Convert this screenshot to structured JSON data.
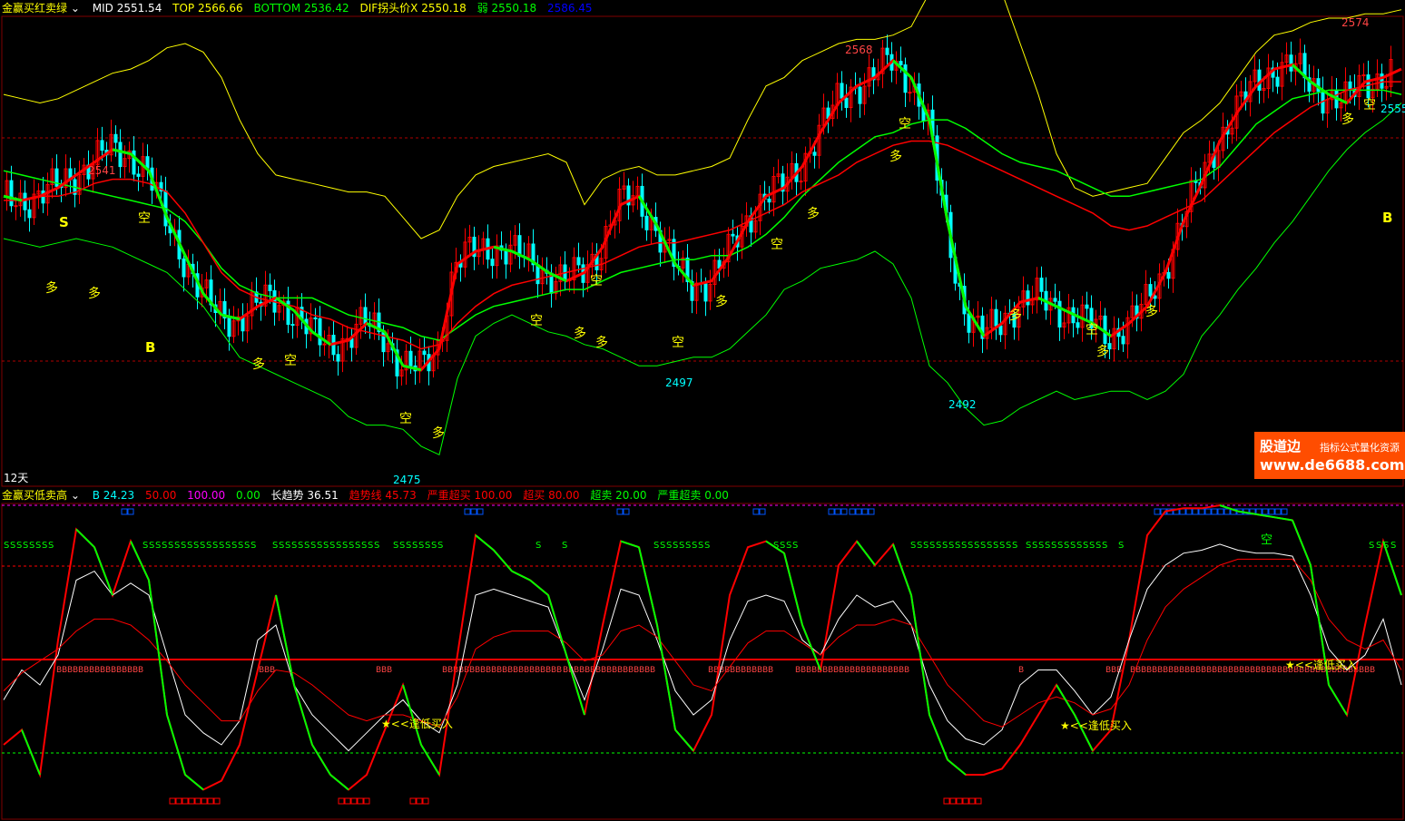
{
  "upper": {
    "indicator_name": "金赢买红卖绿",
    "mid": {
      "label": "MID",
      "value": "2551.54"
    },
    "top": {
      "label": "TOP",
      "value": "2566.66"
    },
    "bottom": {
      "label": "BOTTOM",
      "value": "2536.42"
    },
    "dif": {
      "label": "DIF拐头价X",
      "value": "2550.18"
    },
    "weak": {
      "label": "弱",
      "value": "2550.18"
    },
    "extra": {
      "value": "2586.45"
    },
    "period_label": "12天",
    "right_price": "2555",
    "colors": {
      "mid": "#ffffff",
      "top": "#ffff00",
      "bottom": "#00ff00",
      "dif": "#ffff00",
      "weak": "#00ff00",
      "extra": "#0000ff",
      "up": "#ff0000",
      "down": "#00ffff"
    }
  },
  "lower": {
    "indicator_name": "金赢买低卖高",
    "b": {
      "label": "B",
      "value": "24.23",
      "color": "#00ffff"
    },
    "v1": {
      "value": "50.00",
      "color": "#ff0000"
    },
    "v2": {
      "value": "100.00",
      "color": "#ff00ff"
    },
    "v3": {
      "value": "0.00",
      "color": "#00ff00"
    },
    "long_trend": {
      "label": "长趋势",
      "value": "36.51",
      "color": "#ffffff"
    },
    "trend_line": {
      "label": "趋势线",
      "value": "45.73",
      "color": "#ff0000"
    },
    "severe_overbought": {
      "label": "严重超买",
      "value": "100.00",
      "color": "#ff0000"
    },
    "overbought": {
      "label": "超买",
      "value": "80.00",
      "color": "#ff0000"
    },
    "oversold": {
      "label": "超卖",
      "value": "20.00",
      "color": "#00ff00"
    },
    "severe_oversold": {
      "label": "严重超卖",
      "value": "0.00",
      "color": "#00ff00"
    },
    "buy_label": "★<<逢低买入",
    "empty_label": "空"
  },
  "watermark": {
    "brand": "股道边",
    "tagline": "指标公式量化资源",
    "url": "www.de6688.com"
  },
  "chart_data": [
    {
      "type": "line",
      "title": "金赢买红卖绿",
      "ylim": [
        2470,
        2580
      ],
      "x": [
        0,
        20,
        40,
        60,
        80,
        100,
        120,
        140,
        160,
        180,
        200,
        220,
        240,
        260,
        280,
        300,
        320,
        340,
        360,
        380,
        400,
        420,
        440,
        460,
        480,
        500,
        520,
        540,
        560,
        580,
        600,
        620,
        640,
        660,
        680,
        700,
        720,
        740,
        760,
        780,
        800,
        820,
        840,
        860,
        880,
        900,
        920,
        940,
        960,
        980,
        1000,
        1020,
        1040,
        1060,
        1080,
        1100,
        1120,
        1140,
        1160,
        1180,
        1200,
        1220,
        1240,
        1260,
        1280,
        1300,
        1320,
        1340,
        1360,
        1380,
        1400,
        1420,
        1440,
        1460,
        1480,
        1500,
        1520,
        1540
      ],
      "series": [
        {
          "color": "#ffff00",
          "values": [
            2562,
            2561,
            2560,
            2561,
            2563,
            2565,
            2567,
            2568,
            2570,
            2573,
            2574,
            2572,
            2566,
            2556,
            2548,
            2543,
            2542,
            2541,
            2540,
            2539,
            2539,
            2538,
            2533,
            2528,
            2530,
            2538,
            2543,
            2545,
            2546,
            2547,
            2548,
            2546,
            2536,
            2542,
            2544,
            2545,
            2543,
            2543,
            2544,
            2545,
            2547,
            2556,
            2564,
            2566,
            2570,
            2572,
            2574,
            2575,
            2575,
            2576,
            2578,
            2586,
            2598,
            2600,
            2596,
            2586,
            2574,
            2562,
            2548,
            2540,
            2538,
            2539,
            2540,
            2541,
            2547,
            2553,
            2556,
            2560,
            2566,
            2572,
            2576,
            2577,
            2579,
            2580,
            2580,
            2581,
            2581,
            2582
          ]
        },
        {
          "color": "#00ff00",
          "values": [
            2528,
            2527,
            2526,
            2527,
            2528,
            2527,
            2526,
            2524,
            2522,
            2520,
            2516,
            2512,
            2506,
            2500,
            2498,
            2496,
            2494,
            2492,
            2490,
            2486,
            2484,
            2484,
            2483,
            2479,
            2477,
            2495,
            2505,
            2508,
            2510,
            2508,
            2506,
            2505,
            2503,
            2502,
            2500,
            2498,
            2498,
            2499,
            2500,
            2500,
            2502,
            2506,
            2510,
            2516,
            2518,
            2521,
            2522,
            2523,
            2525,
            2522,
            2514,
            2498,
            2494,
            2488,
            2484,
            2485,
            2488,
            2490,
            2492,
            2490,
            2491,
            2492,
            2492,
            2490,
            2492,
            2496,
            2505,
            2510,
            2516,
            2521,
            2527,
            2532,
            2538,
            2544,
            2549,
            2553,
            2556,
            2560
          ]
        },
        {
          "color": "#00ff00",
          "values": [
            2544,
            2543,
            2542,
            2541,
            2540,
            2539,
            2538,
            2537,
            2536,
            2535,
            2532,
            2527,
            2521,
            2517,
            2515,
            2514,
            2514,
            2514,
            2512,
            2510,
            2509,
            2508,
            2507,
            2505,
            2504,
            2507,
            2510,
            2512,
            2513,
            2514,
            2515,
            2516,
            2516,
            2518,
            2520,
            2521,
            2522,
            2523,
            2523,
            2524,
            2524,
            2526,
            2529,
            2533,
            2538,
            2542,
            2546,
            2549,
            2552,
            2553,
            2555,
            2556,
            2556,
            2554,
            2551,
            2548,
            2546,
            2545,
            2544,
            2542,
            2540,
            2538,
            2538,
            2539,
            2540,
            2541,
            2542,
            2545,
            2550,
            2555,
            2558,
            2561,
            2562,
            2563,
            2563,
            2563,
            2563,
            2562
          ]
        },
        {
          "color": "#ff0000",
          "values": [
            2537,
            2537,
            2538,
            2538,
            2539,
            2541,
            2542,
            2542,
            2541,
            2539,
            2534,
            2527,
            2520,
            2516,
            2514,
            2513,
            2512,
            2510,
            2509,
            2507,
            2506,
            2505,
            2504,
            2502,
            2503,
            2508,
            2512,
            2515,
            2517,
            2518,
            2519,
            2520,
            2521,
            2522,
            2524,
            2526,
            2527,
            2527,
            2528,
            2529,
            2530,
            2532,
            2534,
            2536,
            2539,
            2541,
            2543,
            2546,
            2548,
            2550,
            2551,
            2551,
            2550,
            2548,
            2546,
            2544,
            2542,
            2540,
            2538,
            2536,
            2534,
            2531,
            2530,
            2531,
            2533,
            2535,
            2537,
            2541,
            2545,
            2549,
            2553,
            2556,
            2559,
            2561,
            2563,
            2564,
            2565,
            2565
          ]
        },
        {
          "color": "#ff0000",
          "values": [
            2538,
            2537,
            2538,
            2540,
            2543,
            2546,
            2549,
            2548,
            2544,
            2533,
            2524,
            2515,
            2510,
            2509,
            2512,
            2514,
            2511,
            2506,
            2503,
            2504,
            2508,
            2506,
            2498,
            2497,
            2502,
            2522,
            2525,
            2526,
            2525,
            2523,
            2520,
            2518,
            2520,
            2526,
            2536,
            2538,
            2531,
            2522,
            2517,
            2518,
            2524,
            2532,
            2538,
            2540,
            2545,
            2553,
            2560,
            2564,
            2566,
            2570,
            2566,
            2556,
            2532,
            2512,
            2505,
            2508,
            2513,
            2514,
            2512,
            2510,
            2508,
            2505,
            2508,
            2512,
            2520,
            2532,
            2541,
            2551,
            2558,
            2564,
            2568,
            2569,
            2565,
            2562,
            2560,
            2565,
            2566,
            2568
          ]
        }
      ]
    },
    {
      "type": "line",
      "title": "金赢买低卖高",
      "ylim": [
        0,
        100
      ],
      "x": [
        0,
        20,
        40,
        60,
        80,
        100,
        120,
        140,
        160,
        180,
        200,
        220,
        240,
        260,
        280,
        300,
        320,
        340,
        360,
        380,
        400,
        420,
        440,
        460,
        480,
        500,
        520,
        540,
        560,
        580,
        600,
        620,
        640,
        660,
        680,
        700,
        720,
        740,
        760,
        780,
        800,
        820,
        840,
        860,
        880,
        900,
        920,
        940,
        960,
        980,
        1000,
        1020,
        1040,
        1060,
        1080,
        1100,
        1120,
        1140,
        1160,
        1180,
        1200,
        1220,
        1240,
        1260,
        1280,
        1300,
        1320,
        1340,
        1360,
        1380,
        1400,
        1420,
        1440,
        1460,
        1480,
        1500,
        1520,
        1540
      ],
      "series": [
        {
          "color": "#ff0000",
          "values": [
            20,
            25,
            10,
            55,
            92,
            86,
            70,
            88,
            75,
            30,
            10,
            5,
            8,
            20,
            45,
            70,
            40,
            20,
            10,
            5,
            10,
            25,
            40,
            20,
            10,
            50,
            90,
            85,
            78,
            75,
            70,
            50,
            30,
            60,
            88,
            86,
            60,
            25,
            18,
            30,
            70,
            86,
            88,
            84,
            60,
            45,
            80,
            88,
            80,
            87,
            70,
            30,
            15,
            10,
            10,
            12,
            20,
            30,
            40,
            30,
            18,
            25,
            55,
            90,
            98,
            99,
            99,
            100,
            98,
            97,
            96,
            95,
            80,
            40,
            30,
            60,
            88,
            70
          ]
        },
        {
          "color": "#ffffff",
          "values": [
            35,
            45,
            40,
            50,
            75,
            78,
            70,
            74,
            70,
            50,
            30,
            24,
            20,
            28,
            55,
            60,
            40,
            30,
            24,
            18,
            24,
            30,
            35,
            28,
            24,
            40,
            70,
            72,
            70,
            68,
            66,
            50,
            35,
            52,
            72,
            70,
            55,
            38,
            30,
            35,
            55,
            68,
            70,
            68,
            55,
            50,
            62,
            70,
            66,
            68,
            60,
            40,
            28,
            22,
            20,
            25,
            40,
            45,
            45,
            38,
            30,
            36,
            55,
            72,
            80,
            84,
            85,
            87,
            85,
            84,
            84,
            83,
            70,
            52,
            45,
            50,
            62,
            40
          ]
        },
        {
          "color": "#ff0000",
          "values": [
            38,
            44,
            48,
            52,
            58,
            62,
            62,
            60,
            55,
            48,
            40,
            34,
            28,
            28,
            38,
            45,
            44,
            40,
            35,
            30,
            28,
            30,
            30,
            28,
            26,
            36,
            52,
            56,
            58,
            58,
            58,
            54,
            48,
            50,
            58,
            60,
            56,
            48,
            40,
            38,
            46,
            54,
            58,
            58,
            54,
            50,
            56,
            60,
            60,
            62,
            60,
            50,
            40,
            34,
            28,
            26,
            30,
            34,
            36,
            34,
            30,
            32,
            40,
            55,
            66,
            72,
            76,
            80,
            82,
            82,
            82,
            82,
            75,
            62,
            55,
            52,
            55,
            45
          ]
        }
      ]
    }
  ]
}
